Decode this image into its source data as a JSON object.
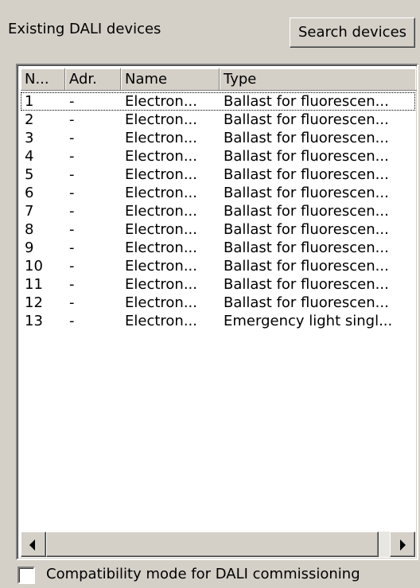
{
  "header": {
    "label": "Existing DALI devices",
    "search_button": "Search devices"
  },
  "table": {
    "columns": [
      "N...",
      "Adr.",
      "Name",
      "Type"
    ],
    "rows": [
      [
        "1",
        "-",
        "Electron...",
        "Ballast for fluorescen..."
      ],
      [
        "2",
        "-",
        "Electron...",
        "Ballast for fluorescen..."
      ],
      [
        "3",
        "-",
        "Electron...",
        "Ballast for fluorescen..."
      ],
      [
        "4",
        "-",
        "Electron...",
        "Ballast for fluorescen..."
      ],
      [
        "5",
        "-",
        "Electron...",
        "Ballast for fluorescen..."
      ],
      [
        "6",
        "-",
        "Electron...",
        "Ballast for fluorescen..."
      ],
      [
        "7",
        "-",
        "Electron...",
        "Ballast for fluorescen..."
      ],
      [
        "8",
        "-",
        "Electron...",
        "Ballast for fluorescen..."
      ],
      [
        "9",
        "-",
        "Electron...",
        "Ballast for fluorescen..."
      ],
      [
        "10",
        "-",
        "Electron...",
        "Ballast for fluorescen..."
      ],
      [
        "11",
        "-",
        "Electron...",
        "Ballast for fluorescen..."
      ],
      [
        "12",
        "-",
        "Electron...",
        "Ballast for fluorescen..."
      ],
      [
        "13",
        "-",
        "Electron...",
        "Emergency light singl..."
      ]
    ],
    "focused_row": 0
  },
  "scrollbar": {
    "left_icon": "scroll-left-arrow-icon",
    "right_icon": "scroll-right-arrow-icon"
  },
  "compat": {
    "label": "Compatibility mode for DALI commissioning",
    "checked": false
  }
}
